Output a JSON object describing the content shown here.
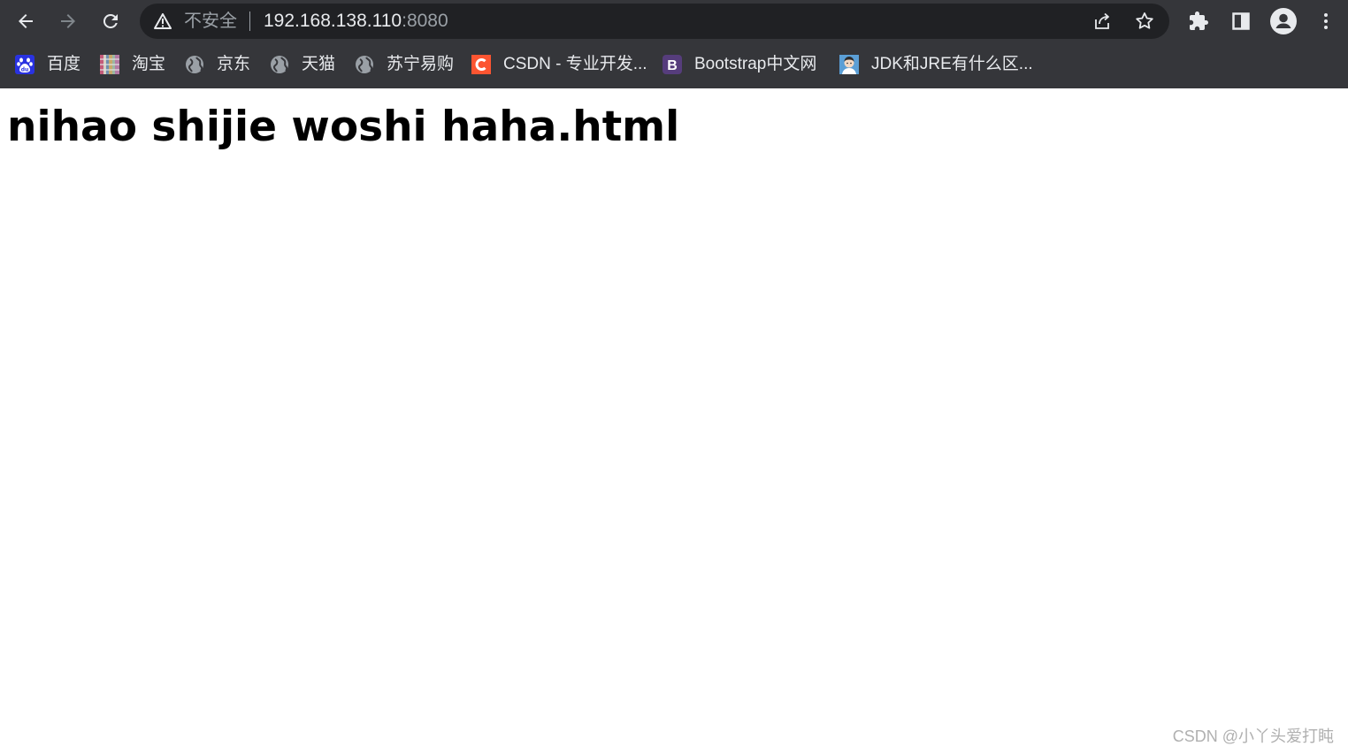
{
  "browser": {
    "security_label": "不安全",
    "url_host": "192.168.138.110",
    "url_port": ":8080",
    "colors": {
      "chrome_bg": "#35363a",
      "omnibox_bg": "#202124",
      "text_primary": "#e8eaed",
      "text_muted": "#9aa0a6"
    },
    "nav_icons": [
      "back-icon",
      "forward-icon",
      "reload-icon"
    ],
    "omnibox_icons": [
      "warning-icon",
      "share-icon",
      "bookmark-star-icon"
    ],
    "toolbar_icons": [
      "extensions-puzzle-icon",
      "side-panel-icon",
      "profile-avatar-icon",
      "menu-kebab-icon"
    ]
  },
  "bookmarks": [
    {
      "label": "百度",
      "icon": "baidu-paw-icon"
    },
    {
      "label": "淘宝",
      "icon": "taobao-icon"
    },
    {
      "label": "京东",
      "icon": "globe-icon"
    },
    {
      "label": "天猫",
      "icon": "globe-icon"
    },
    {
      "label": "苏宁易购",
      "icon": "globe-icon"
    },
    {
      "label": "CSDN - 专业开发...",
      "icon": "csdn-c-icon"
    },
    {
      "label": "Bootstrap中文网",
      "icon": "bootstrap-b-icon"
    },
    {
      "label": "JDK和JRE有什么区...",
      "icon": "avatar-icon"
    }
  ],
  "page": {
    "heading": "nihao shijie woshi haha.html"
  },
  "watermark": "CSDN @小丫头爱打盹"
}
